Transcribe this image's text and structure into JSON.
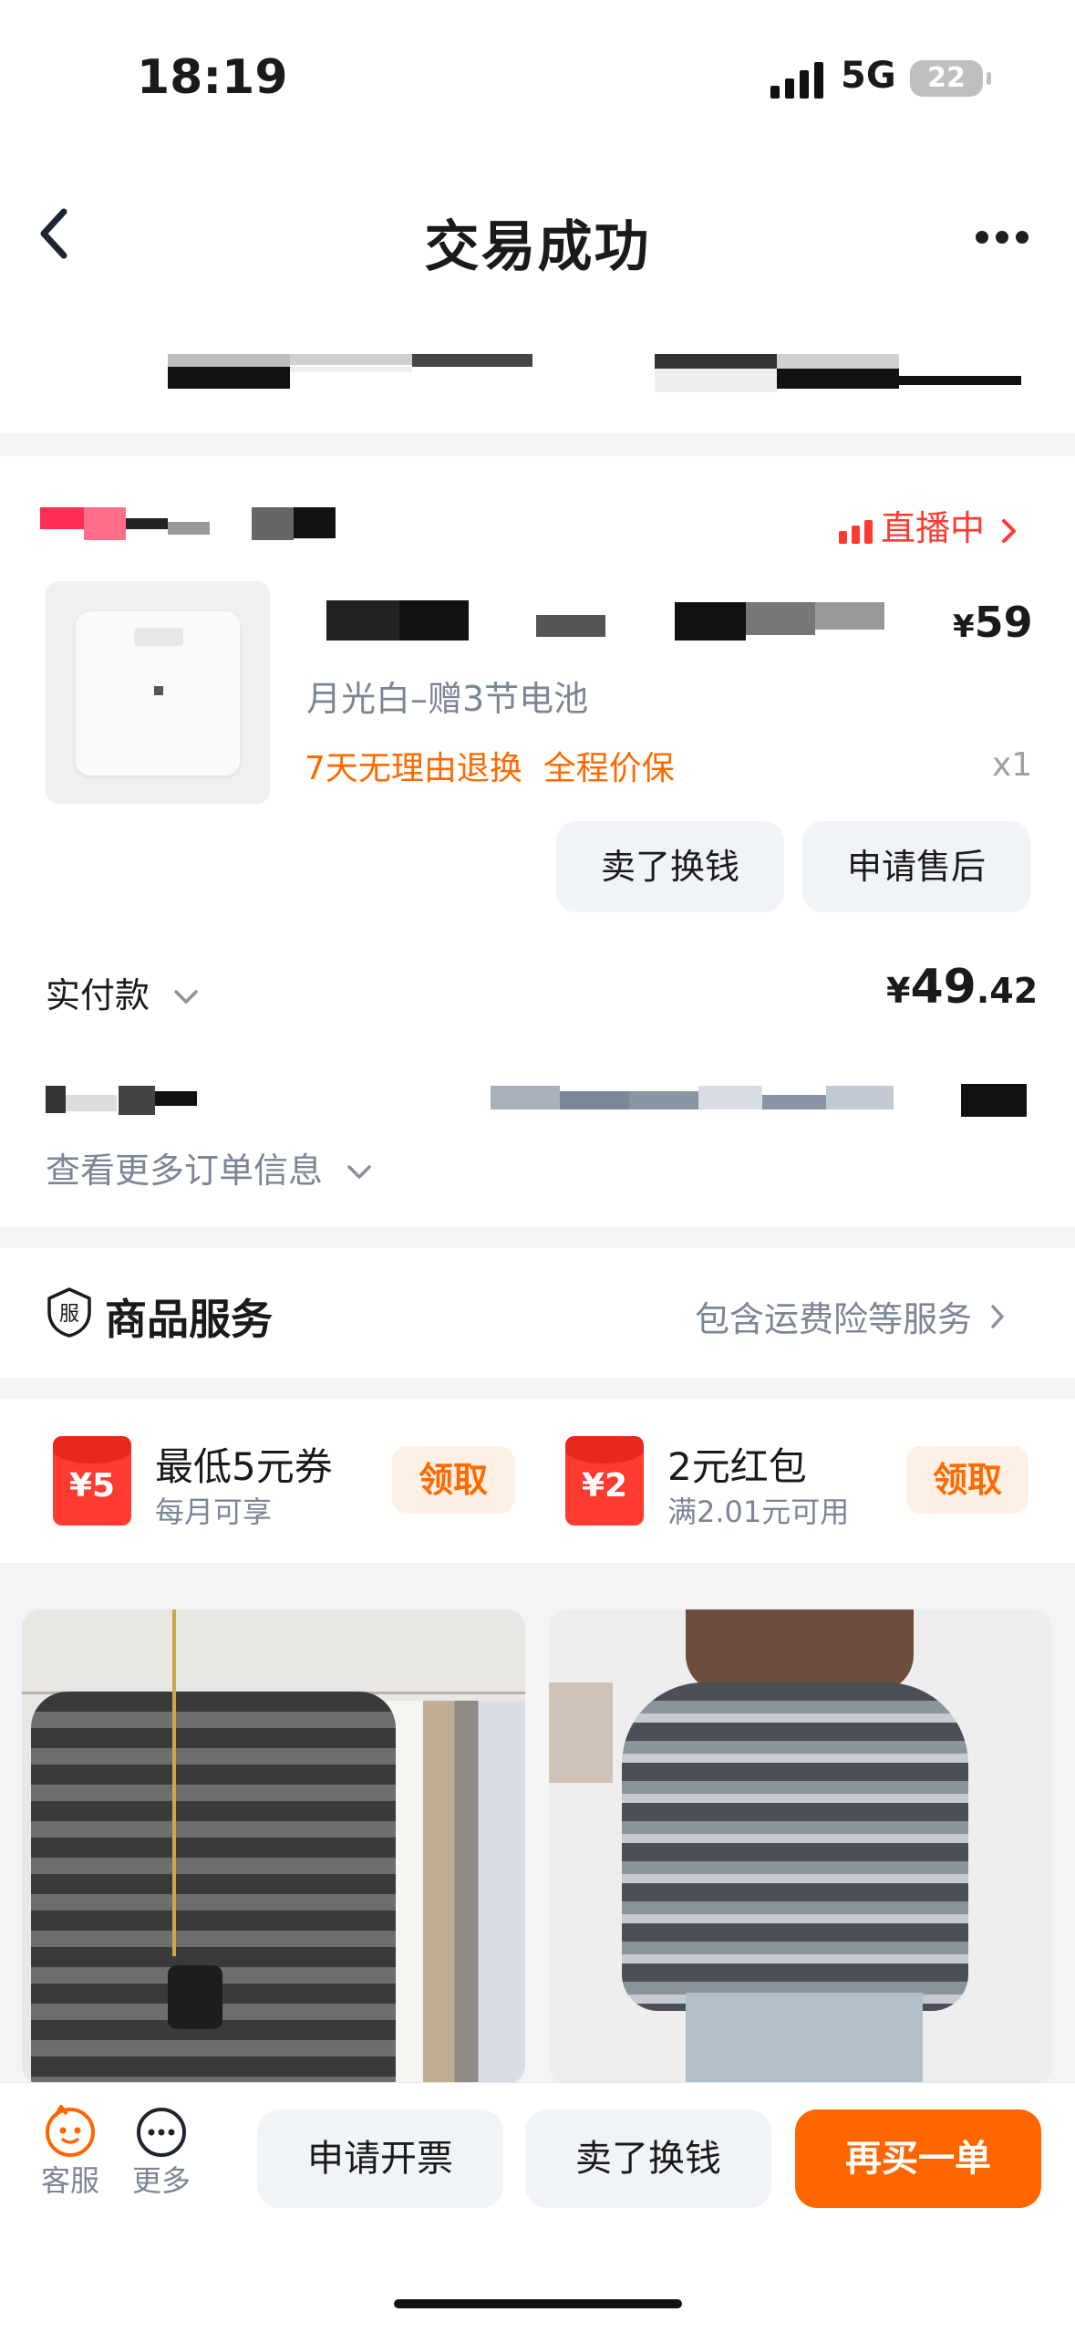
{
  "status_bar": {
    "time": "18:19",
    "network": "5G",
    "battery": "22"
  },
  "nav": {
    "title": "交易成功"
  },
  "order": {
    "live_label": "直播中",
    "price_symbol": "¥",
    "price": "59",
    "spec": "月光白–赠3节电池",
    "tags": "7天无理由退换  全程价保",
    "quantity": "x1",
    "buttons": {
      "sell": "卖了换钱",
      "after_sale": "申请售后"
    },
    "paid_label": "实付款",
    "paid_symbol": "¥",
    "paid_int": "49",
    "paid_dec": ".42",
    "more_info": "查看更多订单信息"
  },
  "service": {
    "icon_char": "服",
    "title": "商品服务",
    "detail": "包含运费险等服务"
  },
  "coupons": [
    {
      "badge": "¥5",
      "title": "最低5元券",
      "subtitle": "每月可享",
      "action": "领取"
    },
    {
      "badge": "¥2",
      "title": "2元红包",
      "subtitle": "满2.01元可用",
      "action": "领取"
    }
  ],
  "bottom_bar": {
    "service_label": "客服",
    "more_label": "更多",
    "invoice": "申请开票",
    "sell": "卖了换钱",
    "rebuy": "再买一单"
  },
  "colors": {
    "accent": "#ff6600",
    "live_red": "#ff3a30",
    "muted": "#7b8595"
  }
}
